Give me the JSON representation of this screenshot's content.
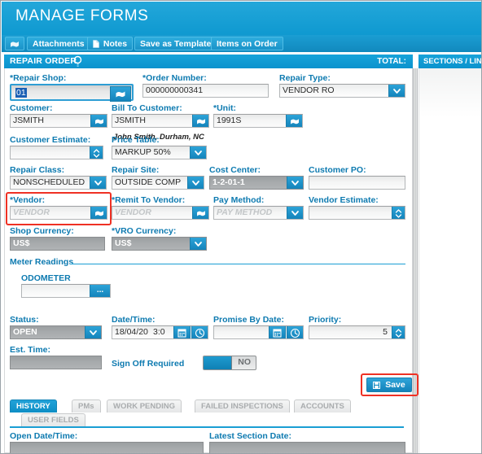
{
  "window": {
    "title": "MANAGE FORMS"
  },
  "toolbar": {
    "home_icon": "home-icon",
    "buttons": [
      {
        "label": "Attachments",
        "icon": ""
      },
      {
        "label": "Notes",
        "icon": "document-icon"
      },
      {
        "label": "Save as Template",
        "icon": ""
      },
      {
        "label": "Items on Order",
        "icon": ""
      }
    ]
  },
  "section": {
    "title": "REPAIR ORDER",
    "magnify_icon": "magnifier-icon",
    "total_label": "TOTAL:"
  },
  "right_panel": {
    "header": "SECTIONS / LINE"
  },
  "form": {
    "repair_shop": {
      "label": "*Repair Shop:",
      "value": "01",
      "lookup_icon": "lookup-icon"
    },
    "order_number": {
      "label": "*Order Number:",
      "value": "000000000341"
    },
    "repair_type": {
      "label": "Repair Type:",
      "value": "VENDOR RO",
      "dropdown_icon": "chevron-down-icon"
    },
    "customer": {
      "label": "Customer:",
      "value": "JSMITH",
      "lookup_icon": "lookup-icon"
    },
    "bill_to_customer": {
      "label": "Bill To Customer:",
      "value": "JSMITH",
      "lookup_icon": "lookup-icon",
      "note": "John Smith, Durham, NC"
    },
    "unit": {
      "label": "*Unit:",
      "value": "1991S",
      "lookup_icon": "lookup-icon"
    },
    "customer_estimate": {
      "label": "Customer Estimate:",
      "value": "",
      "spinner_icon": "spinner-icon"
    },
    "price_table": {
      "label": "Price Table:",
      "value": "MARKUP 50%",
      "dropdown_icon": "chevron-down-icon"
    },
    "repair_class": {
      "label": "Repair Class:",
      "value": "NONSCHEDULED",
      "dropdown_icon": "chevron-down-icon"
    },
    "repair_site": {
      "label": "Repair Site:",
      "value": "OUTSIDE COMP",
      "dropdown_icon": "chevron-down-icon"
    },
    "cost_center": {
      "label": "Cost Center:",
      "value": "1-2-01-1",
      "dropdown_icon": "chevron-down-icon"
    },
    "customer_po": {
      "label": "Customer PO:",
      "value": ""
    },
    "vendor": {
      "label": "*Vendor:",
      "value": "",
      "placeholder": "VENDOR",
      "lookup_icon": "lookup-icon",
      "highlighted": true
    },
    "remit_to_vendor": {
      "label": "*Remit To Vendor:",
      "value": "",
      "placeholder": "VENDOR",
      "lookup_icon": "lookup-icon"
    },
    "pay_method": {
      "label": "Pay Method:",
      "value": "",
      "placeholder": "PAY METHOD",
      "dropdown_icon": "chevron-down-icon"
    },
    "vendor_estimate": {
      "label": "Vendor Estimate:",
      "value": "",
      "spinner_icon": "spinner-icon"
    },
    "shop_currency": {
      "label": "Shop Currency:",
      "value": "US$"
    },
    "vro_currency": {
      "label": "*VRO Currency:",
      "value": "US$",
      "dropdown_icon": "chevron-down-icon"
    },
    "meter_readings": {
      "group_label": "Meter Readings",
      "odometer_label": "ODOMETER",
      "odometer_value": "",
      "dots_label": "..."
    },
    "status": {
      "label": "Status:",
      "value": "OPEN",
      "dropdown_icon": "chevron-down-icon"
    },
    "date_time": {
      "label": "Date/Time:",
      "date_value": "18/04/20",
      "time_value": "3:0",
      "calendar_icon": "calendar-icon",
      "clock_icon": "clock-icon"
    },
    "promise_by_date": {
      "label": "Promise By Date:",
      "value": "",
      "calendar_icon": "calendar-icon",
      "clock_icon": "clock-icon"
    },
    "priority": {
      "label": "Priority:",
      "value": "5",
      "spinner_icon": "spinner-icon"
    },
    "est_time": {
      "label": "Est. Time:",
      "value": ""
    },
    "sign_off": {
      "label": "Sign Off Required",
      "toggle_value": "NO"
    },
    "save": {
      "label": "Save",
      "icon": "save-disk-icon",
      "highlighted": true
    }
  },
  "tabs": {
    "row1": [
      {
        "label": "HISTORY",
        "active": true
      },
      {
        "label": "PMs",
        "active": false
      },
      {
        "label": "WORK PENDING",
        "active": false
      },
      {
        "label": "FAILED INSPECTIONS",
        "active": false
      },
      {
        "label": "ACCOUNTS",
        "active": false
      }
    ],
    "row2": [
      {
        "label": "USER FIELDS",
        "active": false
      }
    ]
  },
  "history": {
    "open_date_time": {
      "label": "Open Date/Time:",
      "value": ""
    },
    "latest_section_date": {
      "label": "Latest Section Date:",
      "value": ""
    }
  },
  "colors": {
    "brand_blue": "#1a9ed4",
    "label_blue": "#0d7ab0",
    "highlight_red": "#ef3124",
    "disabled_gray": "#a8abad"
  }
}
